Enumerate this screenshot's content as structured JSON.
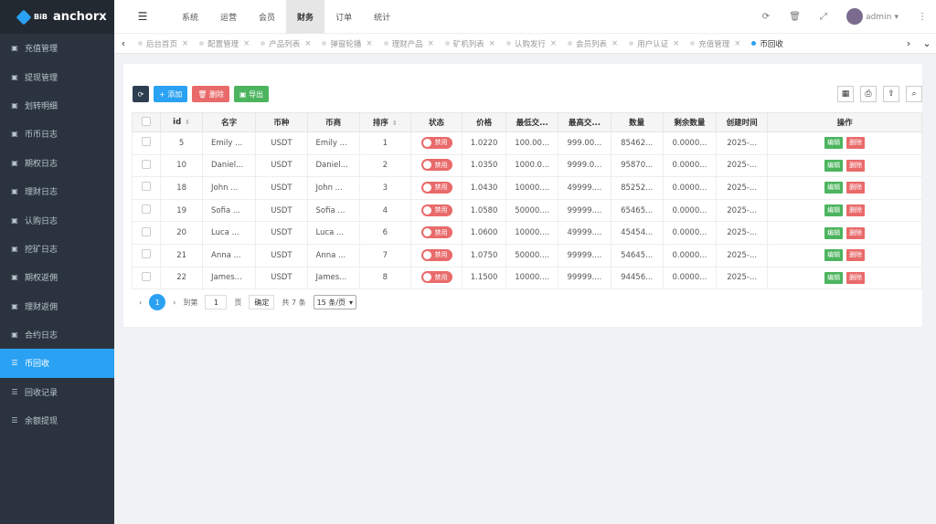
{
  "logo": {
    "bib": "BiB",
    "brand": "anchorx"
  },
  "sidebar": {
    "items": [
      {
        "label": "充值管理",
        "icon": "card-icon"
      },
      {
        "label": "提现管理",
        "icon": "card-icon"
      },
      {
        "label": "划转明细",
        "icon": "card-icon"
      },
      {
        "label": "币币日志",
        "icon": "card-icon"
      },
      {
        "label": "期权日志",
        "icon": "card-icon"
      },
      {
        "label": "理财日志",
        "icon": "card-icon"
      },
      {
        "label": "认购日志",
        "icon": "card-icon"
      },
      {
        "label": "挖矿日志",
        "icon": "card-icon"
      },
      {
        "label": "期权返佣",
        "icon": "card-icon"
      },
      {
        "label": "理财返佣",
        "icon": "card-icon"
      },
      {
        "label": "合约日志",
        "icon": "card-icon"
      },
      {
        "label": "币回收",
        "icon": "list-icon",
        "active": true
      },
      {
        "label": "回收记录",
        "icon": "list-icon"
      },
      {
        "label": "余额提现",
        "icon": "list-icon"
      }
    ]
  },
  "topnav": {
    "items": [
      "系统",
      "运营",
      "会员",
      "财务",
      "订单",
      "统计"
    ],
    "active": "财务",
    "user": "admin"
  },
  "tabs": {
    "items": [
      "后台首页",
      "配置管理",
      "产品列表",
      "弹窗轮播",
      "理财产品",
      "矿机列表",
      "认购发行",
      "会员列表",
      "用户认证",
      "充值管理",
      "币回收"
    ],
    "active": "币回收"
  },
  "toolbar": {
    "add": "+ 添加",
    "delete": "删除",
    "export": "导出"
  },
  "table": {
    "headers": [
      "id",
      "名字",
      "币种",
      "币商",
      "排序",
      "状态",
      "价格",
      "最低交...",
      "最高交...",
      "数量",
      "剩余数量",
      "创建时间",
      "操作"
    ],
    "rows": [
      [
        "5",
        "Emily ...",
        "USDT",
        "Emily ...",
        "1",
        "禁用",
        "1.0220",
        "100.00...",
        "999.00...",
        "85462...",
        "0.0000...",
        "2025-..."
      ],
      [
        "10",
        "Daniel...",
        "USDT",
        "Daniel...",
        "2",
        "禁用",
        "1.0350",
        "1000.0...",
        "9999.0...",
        "95870...",
        "0.0000...",
        "2025-..."
      ],
      [
        "18",
        "John ...",
        "USDT",
        "John ...",
        "3",
        "禁用",
        "1.0430",
        "10000....",
        "49999....",
        "85252...",
        "0.0000...",
        "2025-..."
      ],
      [
        "19",
        "Sofia ...",
        "USDT",
        "Sofia ...",
        "4",
        "禁用",
        "1.0580",
        "50000....",
        "99999....",
        "65465...",
        "0.0000...",
        "2025-..."
      ],
      [
        "20",
        "Luca ...",
        "USDT",
        "Luca ...",
        "6",
        "禁用",
        "1.0600",
        "10000....",
        "49999....",
        "45454...",
        "0.0000...",
        "2025-..."
      ],
      [
        "21",
        "Anna ...",
        "USDT",
        "Anna ...",
        "7",
        "禁用",
        "1.0750",
        "50000....",
        "99999....",
        "54645...",
        "0.0000...",
        "2025-..."
      ],
      [
        "22",
        "James...",
        "USDT",
        "James...",
        "8",
        "禁用",
        "1.1500",
        "10000....",
        "99999....",
        "94456...",
        "0.0000...",
        "2025-..."
      ]
    ],
    "edit_label": "编辑",
    "delete_label": "删除"
  },
  "pager": {
    "current": "1",
    "goto": "到第",
    "page_input": "1",
    "page_unit": "页",
    "confirm": "确定",
    "total": "共 7 条",
    "per_page": "15 条/页"
  }
}
